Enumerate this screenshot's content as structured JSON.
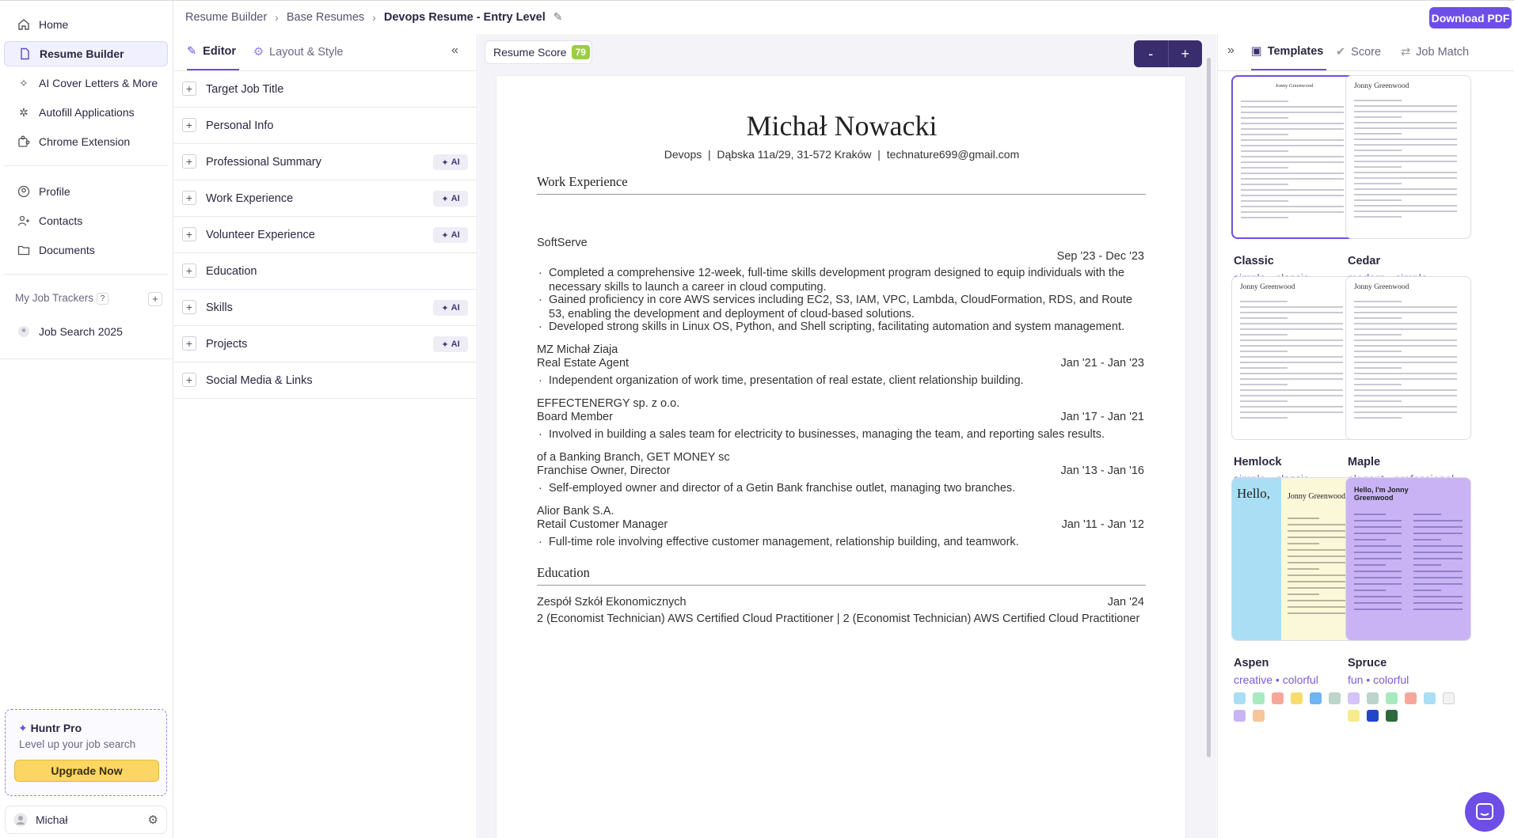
{
  "nav": {
    "items": [
      {
        "label": "Home",
        "icon": "home-icon"
      },
      {
        "label": "Resume Builder",
        "icon": "document-icon",
        "active": true
      },
      {
        "label": "AI Cover Letters & More",
        "icon": "sparkle-icon"
      },
      {
        "label": "Autofill Applications",
        "icon": "wand-icon"
      },
      {
        "label": "Chrome Extension",
        "icon": "puzzle-icon"
      }
    ],
    "secondary": [
      {
        "label": "Profile",
        "icon": "user-circle-icon"
      },
      {
        "label": "Contacts",
        "icon": "contacts-icon"
      },
      {
        "label": "Documents",
        "icon": "folder-icon"
      }
    ],
    "trackers_label": "My Job Trackers",
    "trackers_help": "?",
    "trackers_add": "+",
    "tracker": "Job Search 2025",
    "promo_title": "Huntr Pro",
    "promo_sub": "Level up your job search",
    "upgrade_label": "Upgrade Now",
    "user_name": "Michał"
  },
  "breadcrumb": {
    "items": [
      "Resume Builder",
      "Base Resumes"
    ],
    "current": "Devops Resume - Entry Level"
  },
  "download_label": "Download PDF",
  "editor": {
    "tabs": [
      "Editor",
      "Layout & Style"
    ],
    "ai_label": "AI",
    "sections": [
      {
        "label": "Target Job Title",
        "ai": false
      },
      {
        "label": "Personal Info",
        "ai": false
      },
      {
        "label": "Professional Summary",
        "ai": true
      },
      {
        "label": "Work Experience",
        "ai": true
      },
      {
        "label": "Volunteer Experience",
        "ai": true
      },
      {
        "label": "Education",
        "ai": false
      },
      {
        "label": "Skills",
        "ai": true
      },
      {
        "label": "Projects",
        "ai": true
      },
      {
        "label": "Social Media & Links",
        "ai": false
      }
    ]
  },
  "preview": {
    "score_label": "Resume Score",
    "score_value": "79",
    "zoom_out": "-",
    "zoom_in": "+"
  },
  "resume": {
    "name": "Michał Nowacki",
    "contact": "Devops  |  Dąbska 11a/29, 31-572 Kraków  |  technature699@gmail.com",
    "work_heading": "Work Experience",
    "jobs": [
      {
        "company": "SoftServe",
        "role": "",
        "date": "Sep '23 - Dec '23",
        "bullets": [
          "Completed a comprehensive 12-week, full-time skills development program designed to equip individuals with the necessary skills to launch a career in cloud computing.",
          "Gained proficiency in core AWS services including EC2, S3, IAM, VPC, Lambda, CloudFormation, RDS, and Route 53, enabling the development and deployment of cloud-based solutions.",
          "Developed strong skills in Linux OS, Python, and Shell scripting, facilitating automation and system management."
        ]
      },
      {
        "company": "MZ Michał Ziaja",
        "role": "Real Estate Agent",
        "date": "Jan '21 - Jan '23",
        "bullets": [
          "Independent organization of work time, presentation of real estate, client relationship building."
        ]
      },
      {
        "company": "EFFECTENERGY sp. z o.o.",
        "role": "Board Member",
        "date": "Jan '17 - Jan '21",
        "bullets": [
          "Involved in building a sales team for electricity to businesses, managing the team, and reporting sales results."
        ]
      },
      {
        "company": "of a Banking Branch, GET MONEY sc",
        "role": "Franchise Owner, Director",
        "date": "Jan '13 - Jan '16",
        "bullets": [
          "Self-employed owner and director of a Getin Bank franchise outlet, managing two branches."
        ]
      },
      {
        "company": "Alior Bank S.A.",
        "role": "Retail Customer Manager",
        "date": "Jan '11 - Jan '12",
        "bullets": [
          "Full-time role involving effective customer management, relationship building, and teamwork."
        ]
      }
    ],
    "edu_heading": "Education",
    "school": "Zespół Szkół Ekonomicznych",
    "school_date": "Jan '24",
    "degree": "2 (Economist Technician) AWS Certified Cloud Practitioner | 2 (Economist Technician) AWS Certified Cloud Practitioner"
  },
  "templates": {
    "tabs": [
      "Templates",
      "Score",
      "Job Match"
    ],
    "items": [
      {
        "name": "Classic",
        "sub": "simple • classic",
        "colors": [
          "#ffffff",
          "#444444"
        ],
        "selected": true
      },
      {
        "name": "Cedar",
        "sub": "modern • simple",
        "colors": [
          "#6d4ee6",
          "#555555",
          "#f26a1b",
          "#1e90e8",
          "#2fb344"
        ]
      },
      {
        "name": "Hemlock",
        "sub": "simple • classic",
        "colors": [
          "#f2f2f2",
          "#444444"
        ]
      },
      {
        "name": "Maple",
        "sub": "elegant • professional",
        "colors": [
          "#f2f2f2",
          "#3a3a3a",
          "#2f4a34",
          "#3b4663"
        ]
      },
      {
        "name": "Aspen",
        "sub": "creative • colorful",
        "colors": [
          "#a9def5",
          "#a8eac0",
          "#f5a89a",
          "#f7dd6e",
          "#6cb4f2",
          "#bcd4c9",
          "#c8b4f5",
          "#f7c59a"
        ]
      },
      {
        "name": "Spruce",
        "sub": "fun • colorful",
        "colors": [
          "#d4c4f7",
          "#bcd4c9",
          "#a8eac0",
          "#f5a89a",
          "#a9def5",
          "#f2f2f2",
          "#f7ec8c",
          "#2146c7",
          "#2f6a3c"
        ]
      }
    ],
    "thumb_name": "Jonny Greenwood",
    "thumb_hello": "Hello,",
    "thumb_hello2": "Hello, I'm Jonny Greenwood"
  }
}
